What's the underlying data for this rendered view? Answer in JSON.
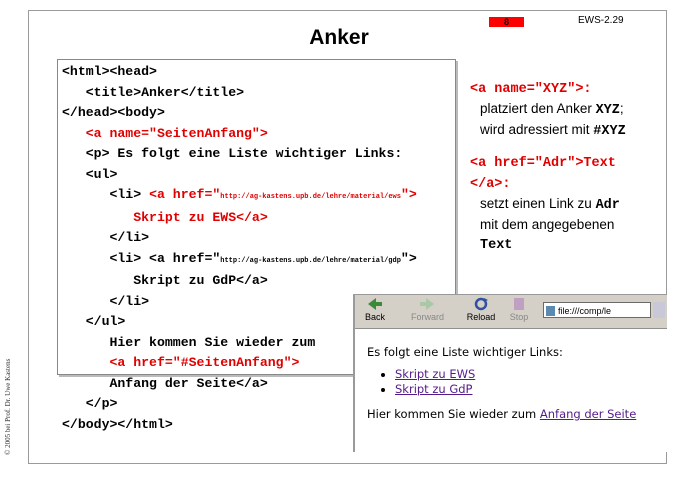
{
  "slide": {
    "badge": "8",
    "id": "EWS-2.29",
    "title": "Anker",
    "copyright": "© 2005 bei Prof. Dr. Uwe Kastens"
  },
  "code": {
    "l1": "<html><head>",
    "l2": "   <title>Anker</title>",
    "l3": "</head><body>",
    "l4": "   <a name=\"SeitenAnfang\">",
    "l5": "   <p> Es folgt eine Liste wichtiger Links:",
    "l6": "   <ul>",
    "l7a": "      <li> ",
    "l7b": "<a href=\"",
    "l7url": "http://ag-kastens.upb.de/lehre/material/ews",
    "l7c": "\">",
    "l8": "         Skript zu EWS</a>",
    "l9": "      </li>",
    "l10a": "      <li> <a href=\"",
    "l10url": "http://ag-kastens.upb.de/lehre/material/gdp",
    "l10b": "\">",
    "l11": "         Skript zu GdP</a>",
    "l12": "      </li>",
    "l13": "   </ul>",
    "l14": "      Hier kommen Sie wieder zum",
    "l15": "      <a href=\"#SeitenAnfang\">",
    "l16": "      Anfang der Seite</a>",
    "l17": "   </p>",
    "l18": "</body></html>"
  },
  "side": {
    "anchor_code": "<a name=\"XYZ\">:",
    "anchor_desc1": "platziert den Anker ",
    "anchor_xyz": "XYZ",
    "anchor_desc1_end": ";",
    "anchor_desc2": "wird adressiert mit ",
    "anchor_ref": "#XYZ",
    "link_code1": "<a href=\"Adr\">Text",
    "link_code2": "</a>:",
    "link_desc1": "setzt einen Link zu ",
    "link_adr": "Adr",
    "link_desc2": "mit dem angegebenen",
    "link_text": "Text"
  },
  "browser": {
    "back": "Back",
    "forward": "Forward",
    "reload": "Reload",
    "stop": "Stop",
    "address": "file:///comp/le",
    "intro": "Es folgt eine Liste wichtiger Links:",
    "links": [
      "Skript zu EWS",
      "Skript zu GdP"
    ],
    "outro": "Hier kommen Sie wieder zum ",
    "anchor_link": "Anfang der Seite"
  }
}
